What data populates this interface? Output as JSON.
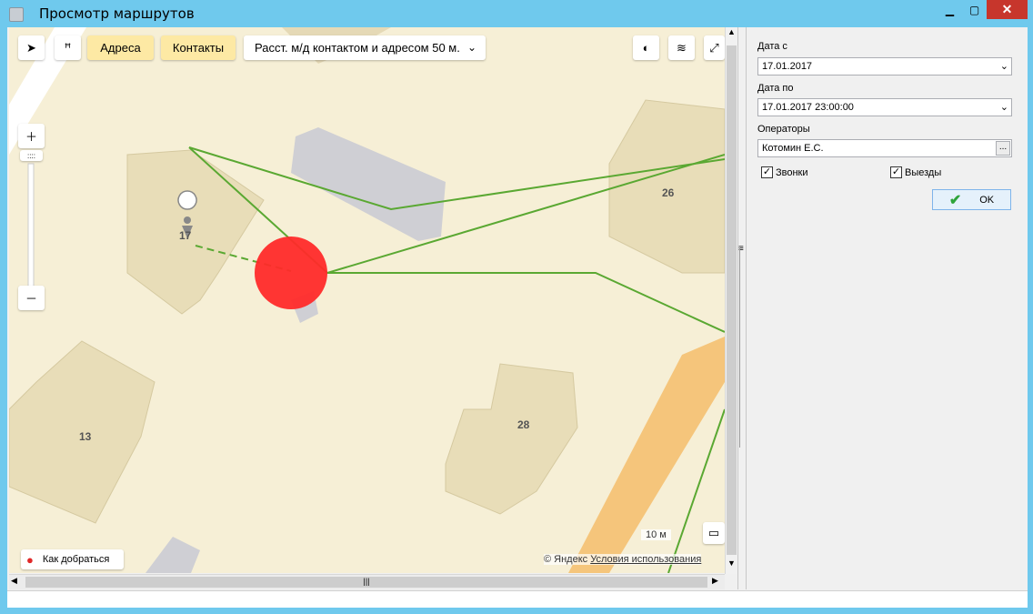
{
  "window": {
    "title": "Просмотр маршрутов"
  },
  "map": {
    "buttons": {
      "addresses": "Адреса",
      "contacts": "Контакты",
      "distance": "Расст. м/д контактом и адресом 50 м."
    },
    "labels": {
      "b13": "13",
      "b17": "17",
      "b26": "26",
      "b28": "28"
    },
    "scale": "10 м",
    "route_link": "Как добраться",
    "attribution_prefix": "© Яндекс",
    "attribution_link": "Условия использования"
  },
  "panel": {
    "date_from_label": "Дата с",
    "date_from_value": "17.01.2017",
    "date_to_label": "Дата по",
    "date_to_value": "17.01.2017 23:00:00",
    "operators_label": "Операторы",
    "operators_value": "Котомин Е.С.",
    "calls_label": "Звонки",
    "calls_checked": true,
    "trips_label": "Выезды",
    "trips_checked": true,
    "ok_label": "OK"
  },
  "colors": {
    "marker": "#ff2a2a",
    "route": "#5aa832",
    "titlebar": "#6fc9ed"
  }
}
